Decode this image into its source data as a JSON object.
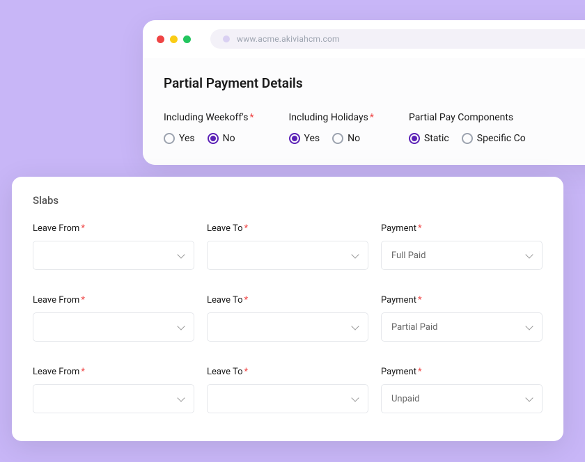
{
  "url": "www.acme.akiviahcm.com",
  "page_title": "Partial Payment Details",
  "radio_groups": {
    "weekoffs": {
      "label": "Including Weekoff's",
      "options": [
        "Yes",
        "No"
      ],
      "selected": "No"
    },
    "holidays": {
      "label": "Including Holidays",
      "options": [
        "Yes",
        "No"
      ],
      "selected": "Yes"
    },
    "components": {
      "label": "Partial Pay Components",
      "options": [
        "Static",
        "Specific Co"
      ],
      "selected": "Static"
    }
  },
  "slabs": {
    "title": "Slabs",
    "rows": [
      {
        "leave_from_label": "Leave From",
        "leave_from_value": "",
        "leave_to_label": "Leave To",
        "leave_to_value": "",
        "payment_label": "Payment",
        "payment_value": "Full Paid"
      },
      {
        "leave_from_label": "Leave From",
        "leave_from_value": "",
        "leave_to_label": "Leave To",
        "leave_to_value": "",
        "payment_label": "Payment",
        "payment_value": "Partial Paid"
      },
      {
        "leave_from_label": "Leave From",
        "leave_from_value": "",
        "leave_to_label": "Leave To",
        "leave_to_value": "",
        "payment_label": "Payment",
        "payment_value": "Unpaid"
      }
    ]
  }
}
